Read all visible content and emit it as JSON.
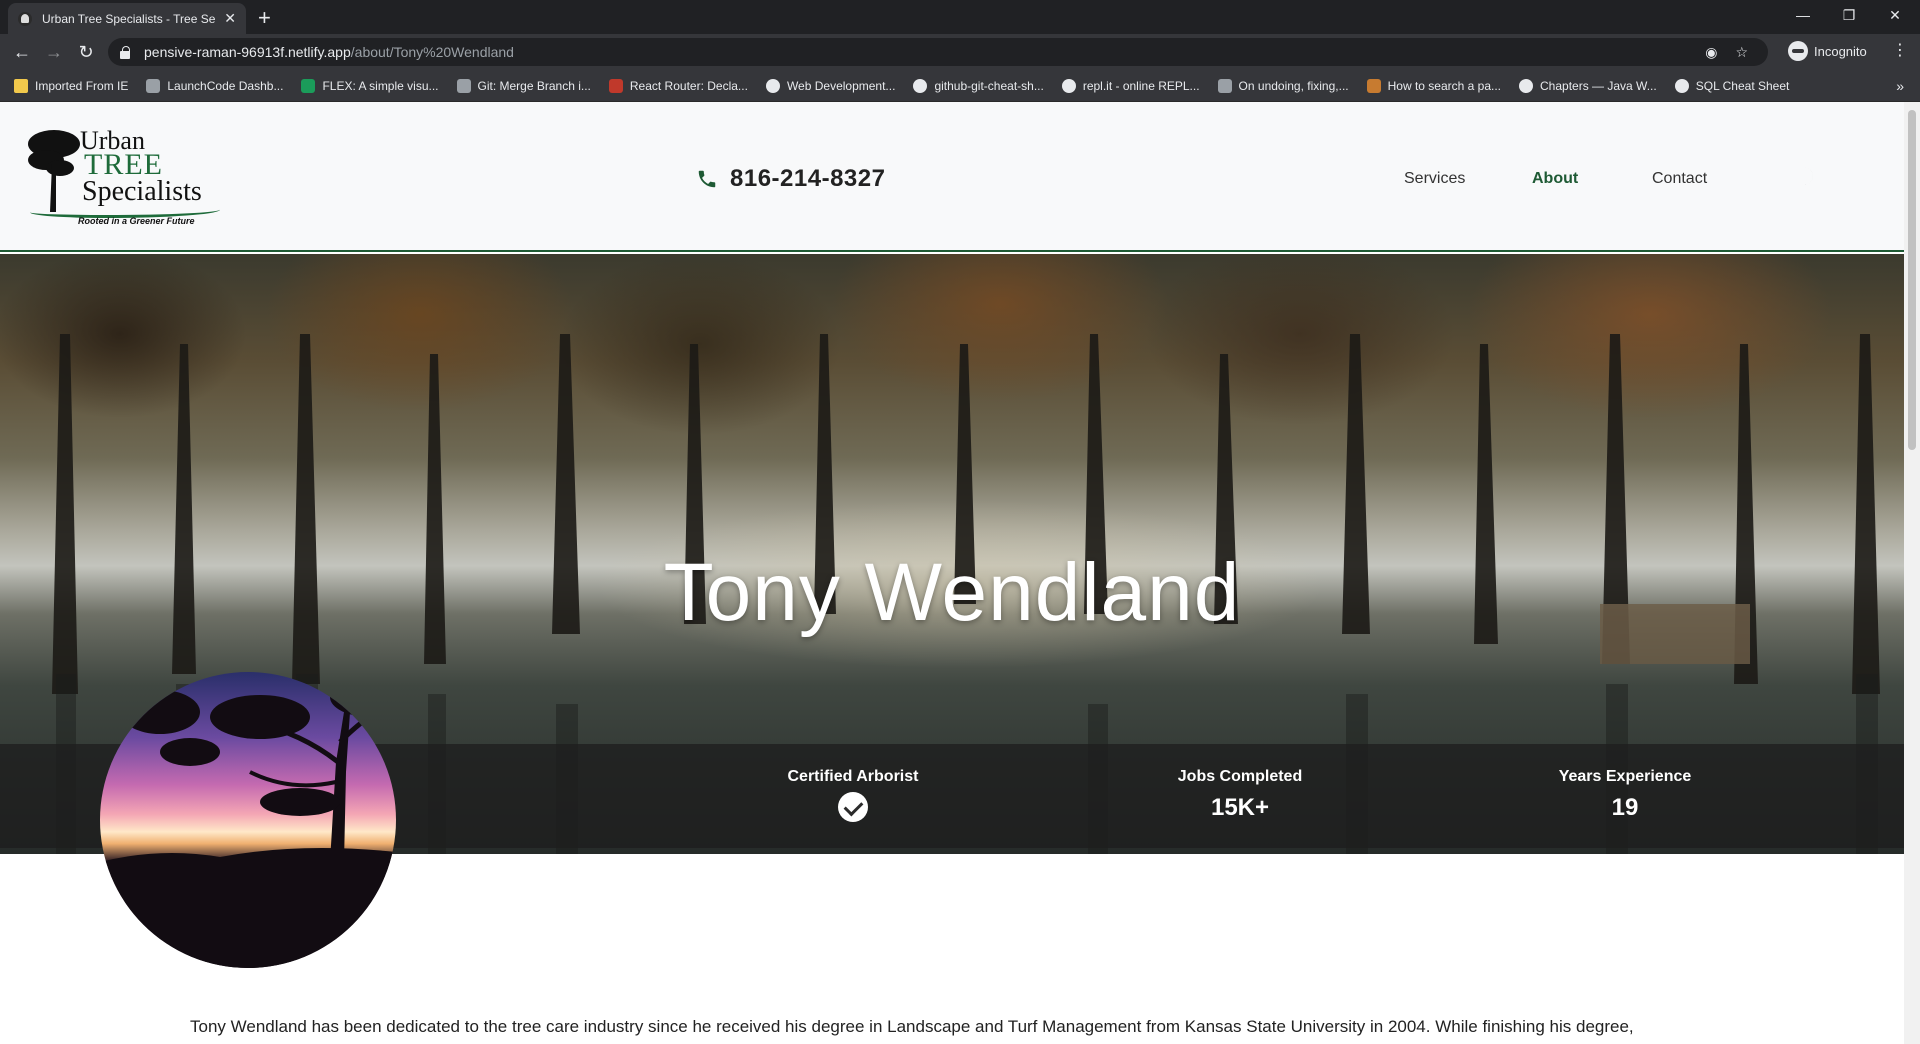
{
  "browser": {
    "tab_title": "Urban Tree Specialists - Tree Serv",
    "url_host": "pensive-raman-96913f.netlify.app",
    "url_path": "/about/Tony%20Wendland",
    "profile_label": "Incognito",
    "bookmarks": [
      {
        "label": "Imported From IE",
        "icon": "folder"
      },
      {
        "label": "LaunchCode Dashb...",
        "icon": "generic"
      },
      {
        "label": "FLEX: A simple visu...",
        "icon": "green"
      },
      {
        "label": "Git: Merge Branch i...",
        "icon": "generic"
      },
      {
        "label": "React Router: Decla...",
        "icon": "red"
      },
      {
        "label": "Web Development...",
        "icon": "circle"
      },
      {
        "label": "github-git-cheat-sh...",
        "icon": "circle"
      },
      {
        "label": "repl.it - online REPL...",
        "icon": "circle"
      },
      {
        "label": "On undoing, fixing,...",
        "icon": "generic"
      },
      {
        "label": "How to search a pa...",
        "icon": "orange"
      },
      {
        "label": "Chapters — Java W...",
        "icon": "circle"
      },
      {
        "label": "SQL Cheat Sheet",
        "icon": "circle"
      }
    ]
  },
  "header": {
    "logo": {
      "line1": "Urban",
      "line2": "TREE",
      "line3": "Specialists",
      "tagline": "Rooted in a Greener Future"
    },
    "phone": "816-214-8327",
    "nav": [
      {
        "label": "Services",
        "active": false
      },
      {
        "label": "About",
        "active": true
      },
      {
        "label": "Contact",
        "active": false
      }
    ],
    "accent_color": "#1e5a34"
  },
  "hero": {
    "title": "Tony Wendland"
  },
  "stats": {
    "certified_label": "Certified Arborist",
    "jobs_label": "Jobs Completed",
    "jobs_value": "15K+",
    "years_label": "Years Experience",
    "years_value": "19"
  },
  "bio": {
    "text": "Tony Wendland has been dedicated to the tree care industry since he received his degree in Landscape and Turf Management from Kansas State University in 2004. While finishing his degree,"
  }
}
